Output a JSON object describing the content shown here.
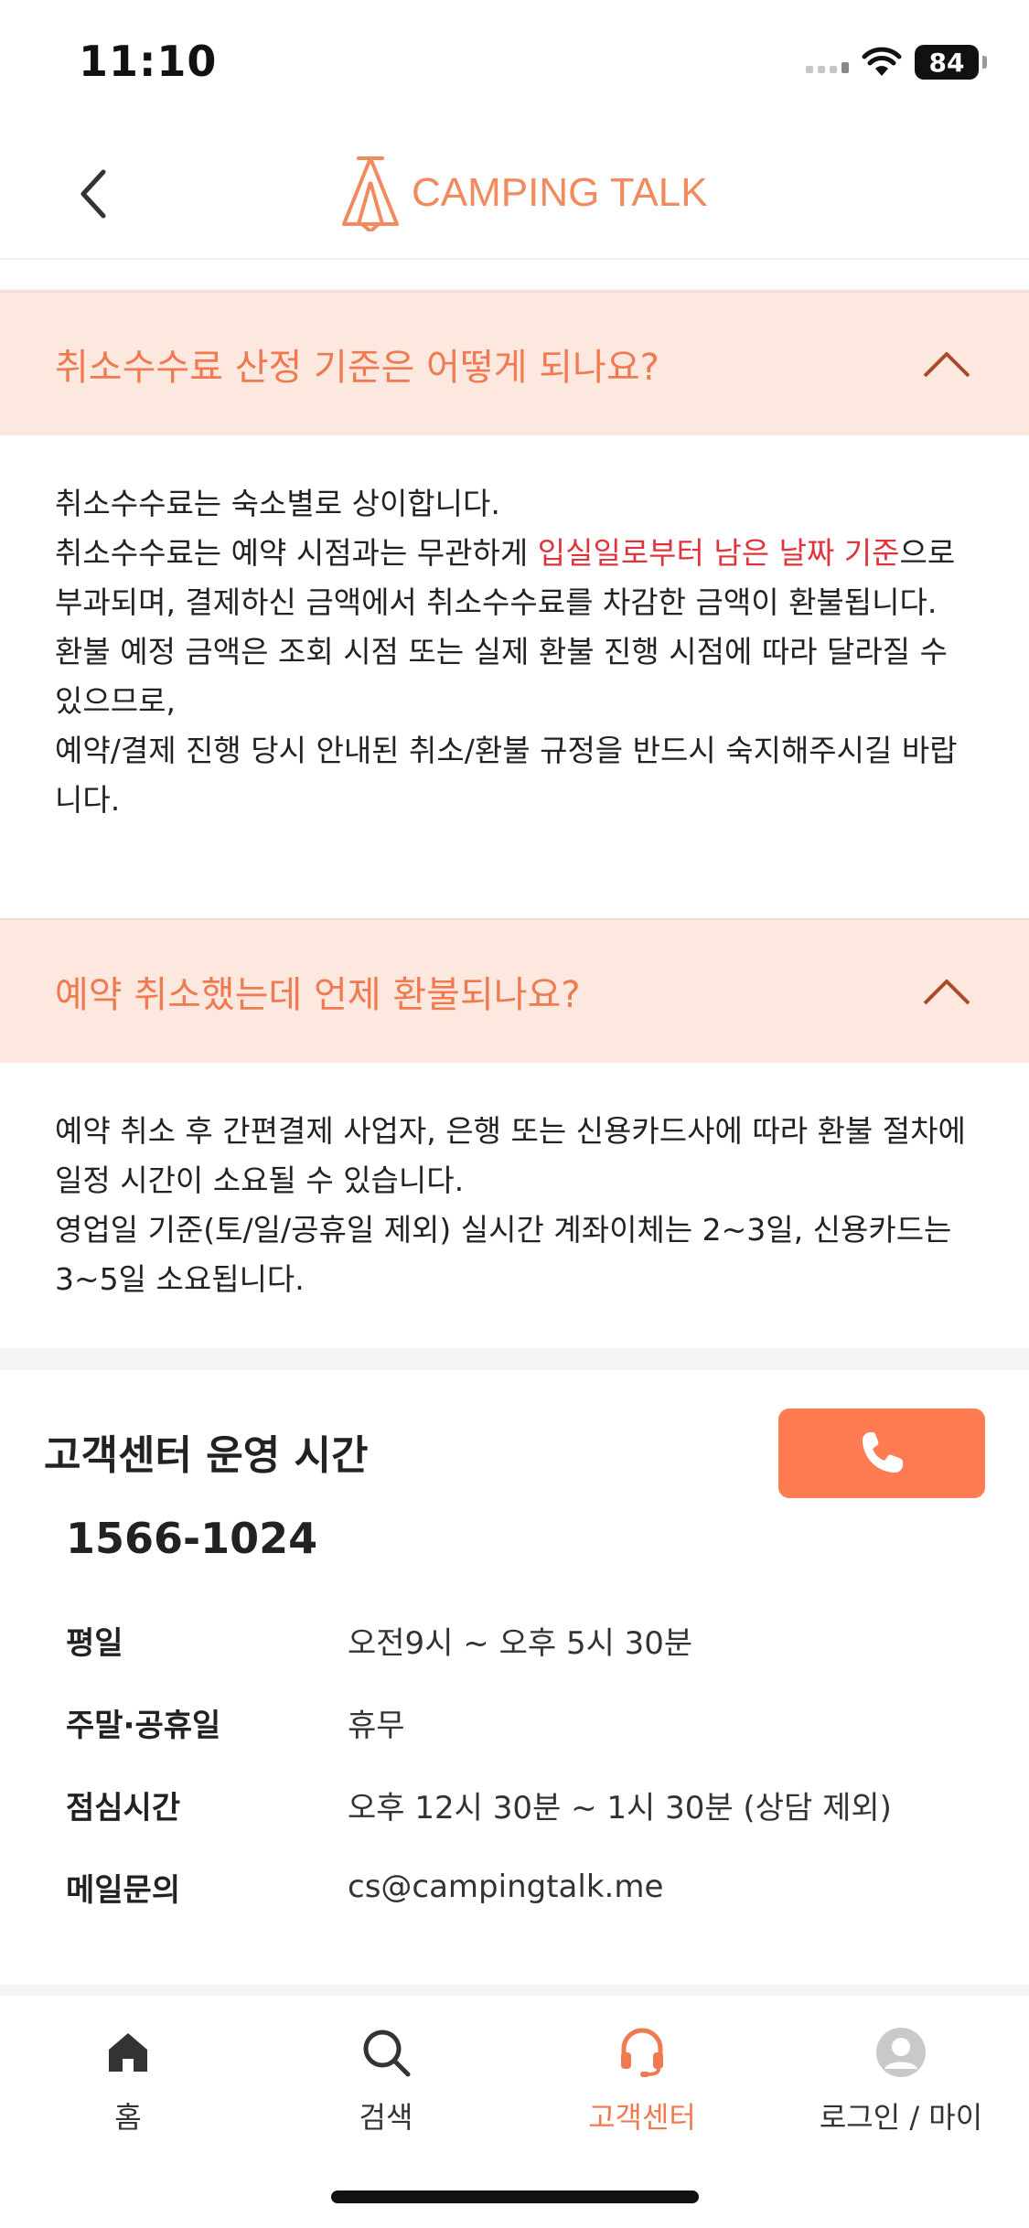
{
  "status_bar": {
    "time": "11:10",
    "battery": "84"
  },
  "header": {
    "brand": "CAMPING TALK"
  },
  "faq": [
    {
      "question": "취소수수료 산정 기준은 어떻게 되나요?",
      "answer_lines": [
        "취소수수료는 숙소별로 상이합니다.",
        "취소수수료는 예약 시점과는 무관하게 ",
        "입실일로부터 남은 날짜 기준",
        "으로 부과되며, 결제하신 금액에서 취소수수료를 차감한 금액이 환불됩니다.",
        "환불 예정 금액은 조회 시점 또는 실제 환불 진행 시점에 따라 달라질 수 있으므로,",
        "예약/결제 진행 당시 안내된 취소/환불 규정을 반드시 숙지해주시길 바랍니다."
      ]
    },
    {
      "question": "예약 취소했는데 언제 환불되나요?",
      "answer_lines": [
        "예약 취소 후 간편결제 사업자, 은행 또는 신용카드사에 따라 환불 절차에 일정 시간이 소요될 수 있습니다.",
        "영업일 기준(토/일/공휴일 제외) 실시간 계좌이체는 2~3일, 신용카드는 3~5일 소요됩니다."
      ]
    }
  ],
  "customer_center": {
    "title": "고객센터 운영 시간",
    "phone": "1566-1024",
    "rows": [
      {
        "label": "평일",
        "value": "오전9시 ~ 오후 5시 30분"
      },
      {
        "label": "주말·공휴일",
        "value": "휴무"
      },
      {
        "label": "점심시간",
        "value": "오후 12시 30분 ~ 1시 30분 (상담 제외)"
      },
      {
        "label": "메일문의",
        "value": "cs@campingtalk.me"
      }
    ]
  },
  "tabs": [
    {
      "label": "홈",
      "icon": "home-icon"
    },
    {
      "label": "검색",
      "icon": "search-icon"
    },
    {
      "label": "고객센터",
      "icon": "headset-icon",
      "active": true
    },
    {
      "label": "로그인 / 마이",
      "icon": "avatar-icon"
    }
  ],
  "colors": {
    "accent": "#ef7a4f",
    "call_button": "#ff7b52",
    "faq_bg": "#fde8e0",
    "highlight": "#e0343c"
  }
}
